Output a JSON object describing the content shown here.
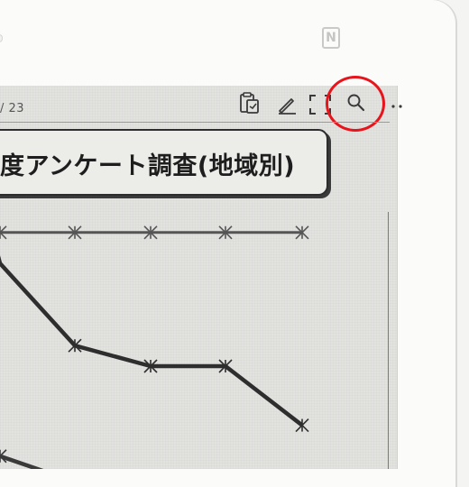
{
  "device": {
    "nfc_mark": "N",
    "bezel_color": "#fbfbfa",
    "screen_color": "#e2e2df"
  },
  "toolbar": {
    "page_number": "/ 23",
    "icons": [
      "clipboard-icon",
      "pen-icon",
      "fit-screen-icon",
      "search-icon",
      "more-icon"
    ],
    "highlight": {
      "target": "search-icon",
      "color": "#e8141c"
    }
  },
  "document": {
    "title": "度アンケート調査(地域別)",
    "chart_data": {
      "type": "line",
      "x": [
        0,
        1,
        2,
        3,
        4
      ],
      "series": [
        {
          "values": [
            92,
            92,
            92,
            92,
            92
          ],
          "markers": [
            "x",
            "x",
            "x",
            "x",
            "x"
          ]
        },
        {
          "values": [
            80,
            48,
            40,
            40,
            17
          ],
          "markers": [
            "none",
            "x",
            "x",
            "x",
            "x"
          ]
        },
        {
          "values": [
            5,
            -5,
            null,
            null,
            null
          ],
          "markers": [
            "x",
            "x",
            "none",
            "none",
            "none"
          ]
        }
      ],
      "ylim": [
        0,
        100
      ],
      "grid": false,
      "colors": [
        "#555555",
        "#2e2e2e",
        "#3a3a3a"
      ]
    }
  }
}
